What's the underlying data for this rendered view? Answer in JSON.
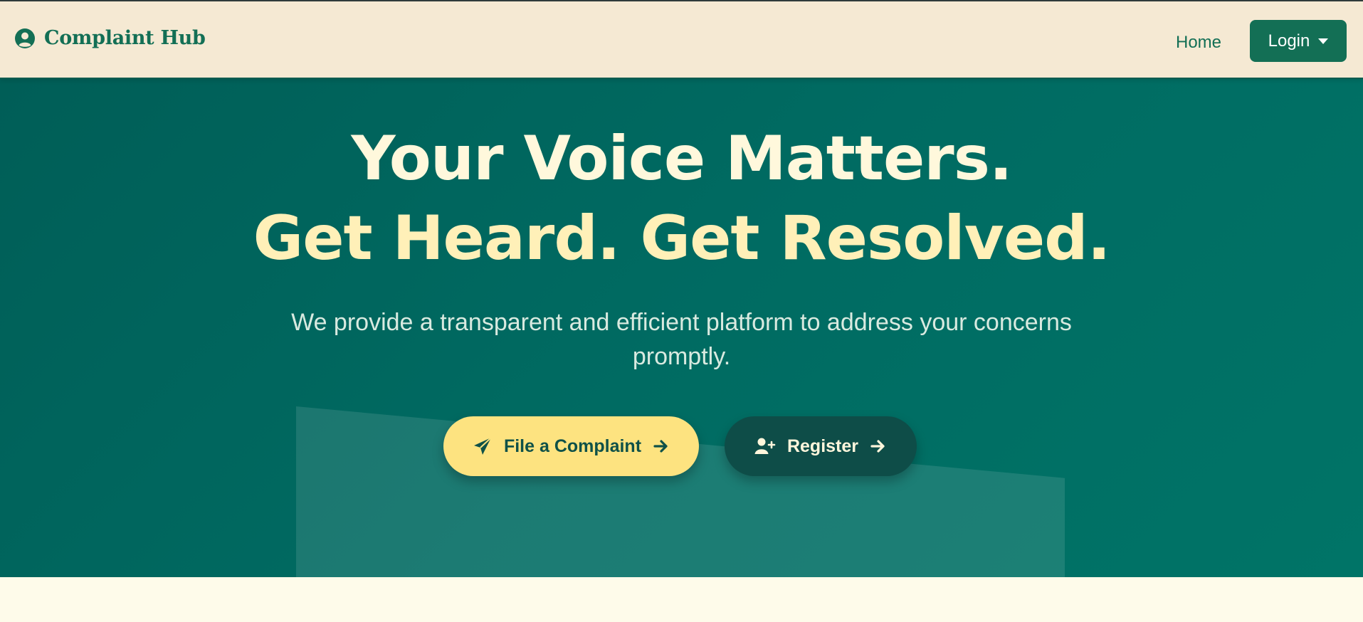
{
  "navbar": {
    "brand": "Complaint Hub",
    "home_label": "Home",
    "login_label": "Login"
  },
  "hero": {
    "title_line1": "Your Voice Matters.",
    "title_line2": "Get Heard. Get Resolved.",
    "subtitle": "We provide a transparent and efficient platform to address your concerns promptly.",
    "file_complaint_label": "File a Complaint",
    "register_label": "Register"
  },
  "icons": {
    "brand": "user-circle-icon",
    "login_caret": "caret-down-icon",
    "file_complaint": "paper-plane-icon",
    "register": "user-plus-icon",
    "arrow": "arrow-right-icon"
  },
  "colors": {
    "navbar_bg": "#f5e9d3",
    "brand_green": "#136f55",
    "hero_bg": "#006b62",
    "primary_button": "#fde380",
    "secondary_button": "#0e4d48",
    "title_text": "#fff8dc"
  }
}
